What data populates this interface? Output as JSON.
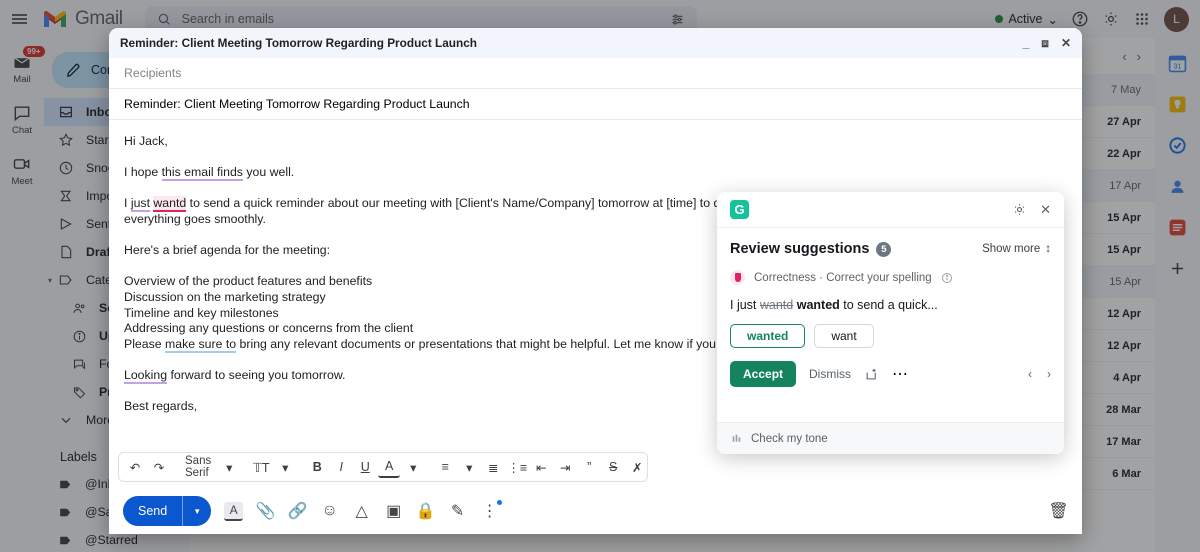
{
  "topbar": {
    "app_name": "Gmail",
    "menu_icon": "hamburger-icon",
    "search_placeholder": "Search in emails",
    "search_icon": "search-icon",
    "filter_icon": "filter-options-icon",
    "status_label": "Active",
    "status_color": "#1e8e3e",
    "status_caret": "⌄",
    "help_icon": "help-icon",
    "settings_icon": "gear-icon",
    "apps_icon": "apps-grid-icon",
    "avatar_initial": "L"
  },
  "rail": {
    "items": [
      {
        "label": "Mail",
        "icon": "mail-icon",
        "badge": "99+"
      },
      {
        "label": "Chat",
        "icon": "chat-icon",
        "badge": ""
      },
      {
        "label": "Meet",
        "icon": "meet-camera-icon",
        "badge": ""
      }
    ]
  },
  "sidebar": {
    "compose_label": "Compose",
    "compose_icon": "pencil-icon",
    "labels_header": "Labels",
    "items": [
      {
        "label": "Inbox",
        "icon": "inbox-icon",
        "state": "active"
      },
      {
        "label": "Starred",
        "icon": "star-icon",
        "state": ""
      },
      {
        "label": "Snoozed",
        "icon": "clock-icon",
        "state": ""
      },
      {
        "label": "Important",
        "icon": "important-marker-icon",
        "state": ""
      },
      {
        "label": "Sent",
        "icon": "send-icon",
        "state": ""
      },
      {
        "label": "Drafts",
        "icon": "draft-page-icon",
        "state": "bold"
      },
      {
        "label": "Categories",
        "icon": "label-tag-icon",
        "state": "",
        "expandable": true
      },
      {
        "label": "Social",
        "icon": "people-icon",
        "state": "bold",
        "sub": true
      },
      {
        "label": "Updates",
        "icon": "info-circle-icon",
        "state": "bold",
        "sub": true
      },
      {
        "label": "Forums",
        "icon": "forum-icon",
        "state": "",
        "sub": true
      },
      {
        "label": "Promotions",
        "icon": "price-tag-icon",
        "state": "bold",
        "sub": true
      },
      {
        "label": "More",
        "icon": "chevron-down-icon",
        "state": ""
      }
    ],
    "labels": [
      {
        "label": "@Inbox",
        "icon": "label-icon"
      },
      {
        "label": "@Saved",
        "icon": "label-icon"
      },
      {
        "label": "@Starred",
        "icon": "label-icon"
      }
    ]
  },
  "mail_list": {
    "prev_icon": "chevron-left-icon",
    "next_icon": "chevron-right-icon",
    "rows": [
      {
        "sender": "",
        "subject": "",
        "date": "7 May",
        "read": true
      },
      {
        "sender": "",
        "subject": "",
        "date": "27 Apr",
        "read": false
      },
      {
        "sender": "",
        "subject": "",
        "date": "22 Apr",
        "read": false
      },
      {
        "sender": "",
        "subject": "",
        "date": "17 Apr",
        "read": true
      },
      {
        "sender": "",
        "subject": "",
        "date": "15 Apr",
        "read": false
      },
      {
        "sender": "",
        "subject": "",
        "date": "15 Apr",
        "read": false
      },
      {
        "sender": "",
        "subject": "",
        "date": "15 Apr",
        "read": true
      },
      {
        "sender": "",
        "subject": "",
        "date": "12 Apr",
        "read": false
      },
      {
        "sender": "",
        "subject": "",
        "date": "12 Apr",
        "read": false
      },
      {
        "sender": "",
        "subject": "",
        "date": "4 Apr",
        "read": false
      },
      {
        "sender": "",
        "subject": "",
        "date": "28 Mar",
        "read": false
      },
      {
        "sender": "",
        "subject": "",
        "date": "17 Mar",
        "read": false
      },
      {
        "sender": "",
        "subject": "",
        "date": "6 Mar",
        "read": false
      }
    ]
  },
  "app_rail": {
    "items": [
      {
        "name": "google-calendar-icon",
        "color": "#1a73e8"
      },
      {
        "name": "google-keep-icon",
        "color": "#fbbc04"
      },
      {
        "name": "google-tasks-icon",
        "color": "#1a73e8"
      },
      {
        "name": "google-contacts-icon",
        "color": "#1a73e8"
      },
      {
        "name": "todoist-icon",
        "color": "#e44332"
      },
      {
        "name": "add-addon-icon",
        "color": "#5f6368"
      }
    ],
    "add_label": "+"
  },
  "compose": {
    "window_title": "Reminder: Client Meeting Tomorrow Regarding Product Launch",
    "minimize_icon": "minimize-icon",
    "popout_icon": "popout-icon",
    "close_icon": "close-icon",
    "recipients_placeholder": "Recipients",
    "subject_value": "Reminder: Client Meeting Tomorrow Regarding Product Launch",
    "body": {
      "greeting": "Hi Jack,",
      "line_hope_pre": "I hope ",
      "line_hope_underlined": "this email finds",
      "line_hope_post": " you well.",
      "line_just_pre": "I ",
      "line_just_purple": "just",
      "line_just_mid": " ",
      "line_just_misspelled": "wantd",
      "line_just_post": " to send a quick reminder about our meeting with [Client's Name/Company] tomorrow at [time] to discuss the upcoming product launch. I want to ensure everything goes smoothly.",
      "agenda_intro": "Here's a brief agenda for the meeting:",
      "agenda": [
        "Overview of the product features and benefits",
        "Discussion on the marketing strategy",
        "Timeline and key milestones",
        "Addressing any questions or concerns from the client"
      ],
      "please_pre": "Please ",
      "please_underlined": "make sure to",
      "please_post": " bring any relevant documents or presentations that might be helpful. Let me know if you need any assistance.",
      "closing_underlined": "Looking",
      "closing_post": " forward to seeing you tomorrow.",
      "signoff": "Best regards,"
    },
    "toolbar": {
      "undo_icon": "undo-icon",
      "redo_icon": "redo-icon",
      "font_name": "Sans Serif",
      "font_caret": "▾",
      "font_size_icon": "font-size-icon",
      "bold_label": "B",
      "italic_label": "I",
      "underline_label": "U",
      "text_color_label": "A",
      "align_icon": "align-icon",
      "numbered_list_icon": "numbered-list-icon",
      "bulleted_list_icon": "bulleted-list-icon",
      "indent_less_icon": "indent-less-icon",
      "indent_more_icon": "indent-more-icon",
      "quote_icon": "blockquote-icon",
      "strikethrough_icon": "strikethrough-icon",
      "remove_format_icon": "remove-formatting-icon"
    },
    "footer": {
      "send_label": "Send",
      "send_caret": "▼",
      "format_icon": "format-text-icon",
      "attach_icon": "attach-file-icon",
      "link_icon": "insert-link-icon",
      "emoji_icon": "emoji-icon",
      "drive_icon": "google-drive-icon",
      "photo_icon": "insert-photo-icon",
      "confidential_icon": "confidential-mode-lock-icon",
      "signature_icon": "signature-pen-icon",
      "more_icon": "more-options-icon",
      "discard_icon": "delete-draft-icon"
    }
  },
  "grammarly": {
    "logo_letter": "G",
    "brand_color": "#15c39a",
    "settings_icon": "gear-icon",
    "close_icon": "close-icon",
    "title": "Review suggestions",
    "count": "5",
    "show_more_label": "Show more",
    "show_more_icon": "expand-collapse-icon",
    "category": "Correctness · Correct your spelling",
    "info_icon": "info-icon",
    "preview_pre": "I just ",
    "preview_strike": "wantd",
    "preview_bold": "wanted",
    "preview_post": " to send a quick...",
    "alternatives": [
      {
        "label": "wanted",
        "selected": true
      },
      {
        "label": "want",
        "selected": false
      }
    ],
    "accept_label": "Accept",
    "dismiss_label": "Dismiss",
    "add_dictionary_icon": "add-to-dictionary-icon",
    "more_icon": "more-options-icon",
    "prev_icon": "chevron-left-icon",
    "next_icon": "chevron-right-icon",
    "tone_label": "Check my tone",
    "tone_icon": "tone-detector-icon"
  }
}
